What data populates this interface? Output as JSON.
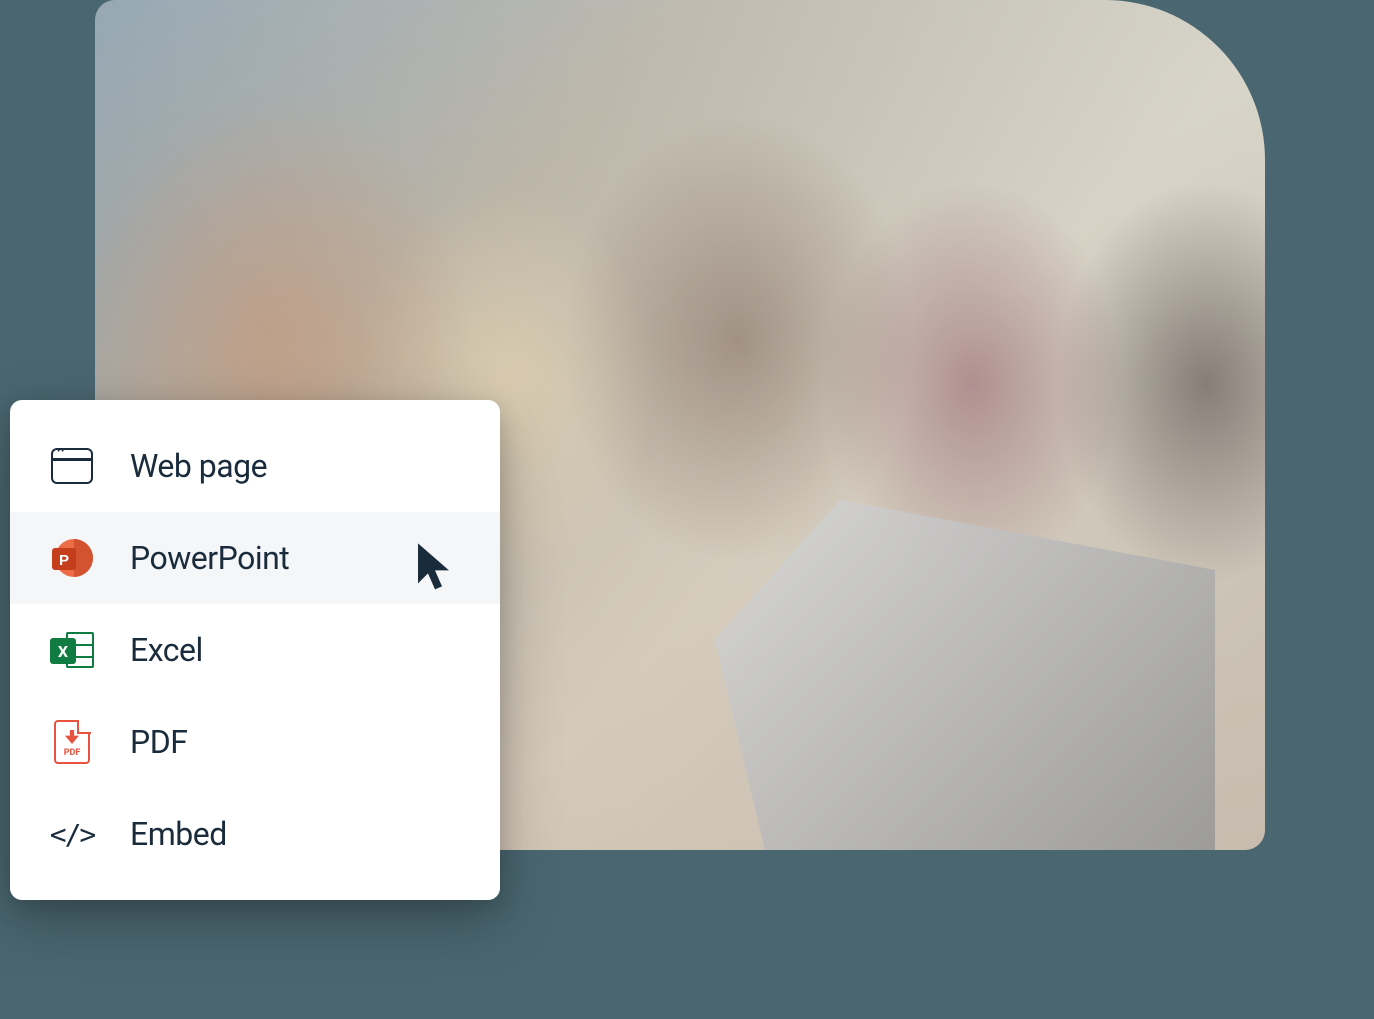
{
  "export_menu": {
    "items": [
      {
        "label": "Web page",
        "icon": "webpage"
      },
      {
        "label": "PowerPoint",
        "icon": "powerpoint",
        "hovered": true
      },
      {
        "label": "Excel",
        "icon": "excel"
      },
      {
        "label": "PDF",
        "icon": "pdf"
      },
      {
        "label": "Embed",
        "icon": "embed"
      }
    ]
  }
}
